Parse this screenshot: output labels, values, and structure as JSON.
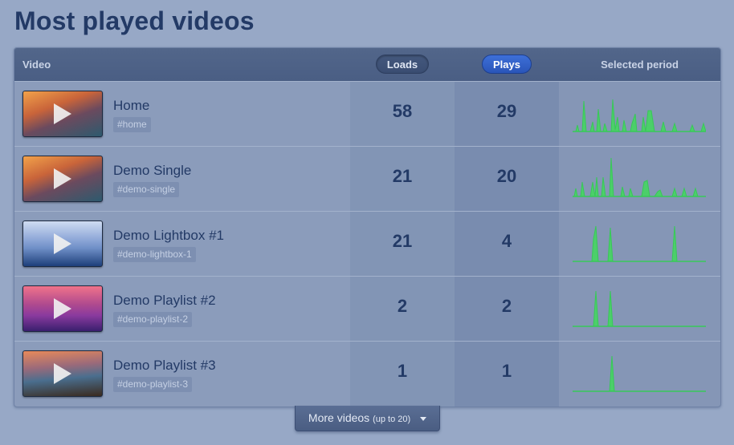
{
  "page": {
    "title": "Most played videos"
  },
  "table": {
    "headers": {
      "video": "Video",
      "loads": "Loads",
      "plays": "Plays",
      "period": "Selected period"
    },
    "active_sort": "Plays",
    "rows": [
      {
        "title": "Home",
        "tag": "#home",
        "loads": "58",
        "plays": "29",
        "thumb_colors": [
          "#f2a24a",
          "#6b4a5e",
          "#2d5a6e"
        ],
        "icon": "play-icon"
      },
      {
        "title": "Demo Single",
        "tag": "#demo-single",
        "loads": "21",
        "plays": "20",
        "thumb_colors": [
          "#f2a24a",
          "#6b4a5e",
          "#2d5a6e"
        ],
        "icon": "play-icon"
      },
      {
        "title": "Demo Lightbox #1",
        "tag": "#demo-lightbox-1",
        "loads": "21",
        "plays": "4",
        "thumb_colors": [
          "#cfdcf2",
          "#6f8fc7",
          "#1d3f7a"
        ],
        "icon": "play-icon"
      },
      {
        "title": "Demo Playlist #2",
        "tag": "#demo-playlist-2",
        "loads": "2",
        "plays": "2",
        "thumb_colors": [
          "#f0738a",
          "#8a3a9e",
          "#3a1f6e"
        ],
        "icon": "play-icon"
      },
      {
        "title": "Demo Playlist #3",
        "tag": "#demo-playlist-3",
        "loads": "1",
        "plays": "1",
        "thumb_colors": [
          "#e88a5a",
          "#4a6e8e",
          "#3a2a1e"
        ],
        "icon": "play-icon"
      }
    ]
  },
  "more_button": {
    "label": "More videos",
    "note": "(up to 20)",
    "icon": "caret-down-icon"
  },
  "colors": {
    "accent": "#2a55b8",
    "title": "#233a66",
    "spark_fill": "#4ccf6a",
    "spark_line": "#38c858"
  }
}
